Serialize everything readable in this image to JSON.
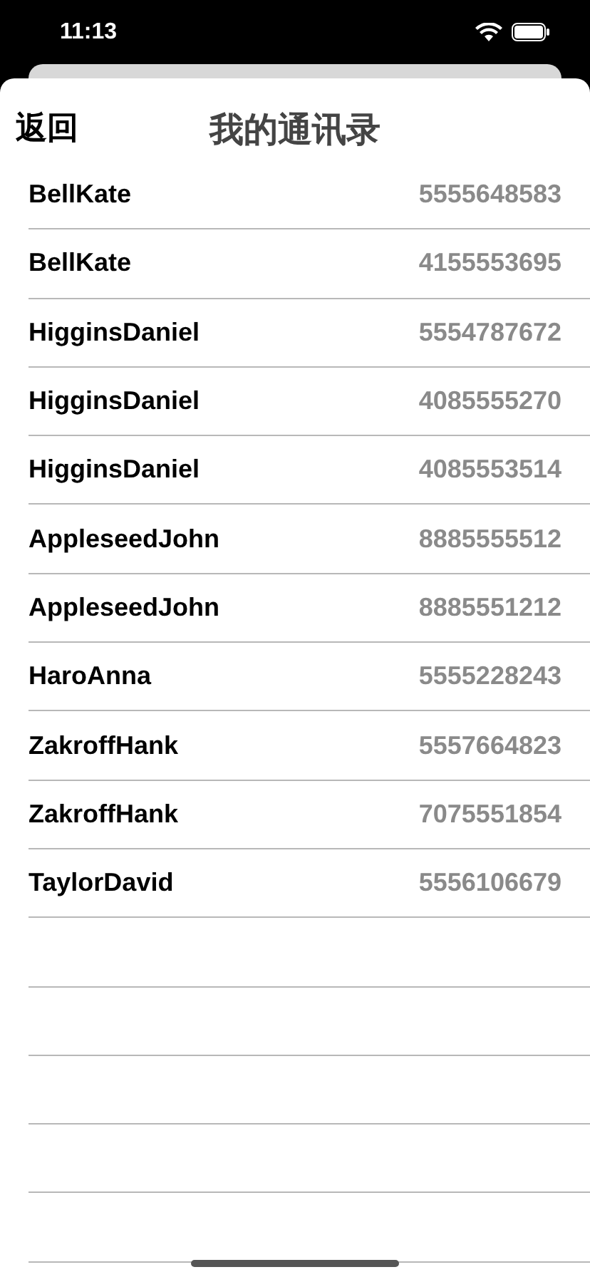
{
  "status_bar": {
    "time": "11:13"
  },
  "nav": {
    "back": "返回",
    "title": "我的通讯录"
  },
  "contacts": [
    {
      "name": "BellKate",
      "phone": "5555648583"
    },
    {
      "name": "BellKate",
      "phone": "4155553695"
    },
    {
      "name": "HigginsDaniel",
      "phone": "5554787672"
    },
    {
      "name": "HigginsDaniel",
      "phone": "4085555270"
    },
    {
      "name": "HigginsDaniel",
      "phone": "4085553514"
    },
    {
      "name": "AppleseedJohn",
      "phone": "8885555512"
    },
    {
      "name": "AppleseedJohn",
      "phone": "8885551212"
    },
    {
      "name": "HaroAnna",
      "phone": "5555228243"
    },
    {
      "name": "ZakroffHank",
      "phone": "5557664823"
    },
    {
      "name": "ZakroffHank",
      "phone": "7075551854"
    },
    {
      "name": "TaylorDavid",
      "phone": "5556106679"
    }
  ]
}
